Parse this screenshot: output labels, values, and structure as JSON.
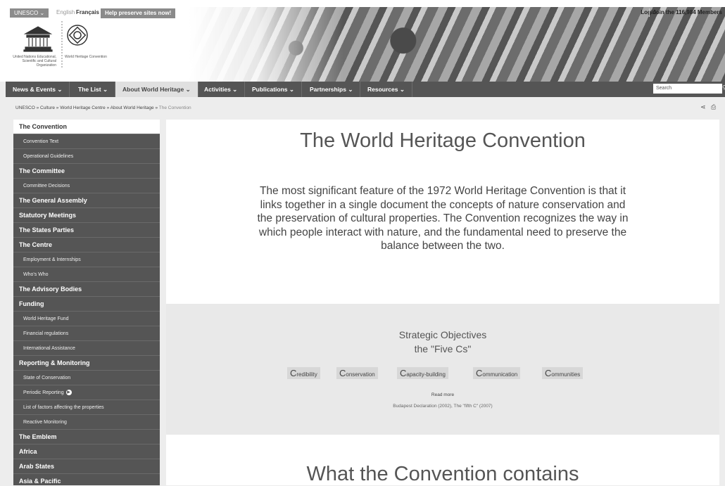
{
  "header": {
    "unesco_label": "UNESCO",
    "lang_en": "English",
    "lang_fr": "Français",
    "help_label": "Help preserve sites now!",
    "login_label": "Login",
    "join_label": "Join the 116,984 Members",
    "org_text": "United Nations Educational, Scientific and Cultural Organization",
    "wh_text": "World Heritage Convention"
  },
  "nav": {
    "items": [
      "News & Events",
      "The List",
      "About World Heritage",
      "Activities",
      "Publications",
      "Partnerships",
      "Resources"
    ],
    "search_placeholder": "Search"
  },
  "breadcrumb": {
    "path": "UNESCO » Culture » World Heritage Centre » About World Heritage »",
    "current": "The Convention"
  },
  "sidebar": {
    "items": [
      {
        "label": "The Convention",
        "level": "top",
        "active": true
      },
      {
        "label": "Convention Text",
        "level": "sub"
      },
      {
        "label": "Operational Guidelines",
        "level": "sub"
      },
      {
        "label": "The Committee",
        "level": "top"
      },
      {
        "label": "Committee Decisions",
        "level": "sub"
      },
      {
        "label": "The General Assembly",
        "level": "top"
      },
      {
        "label": "Statutory Meetings",
        "level": "top"
      },
      {
        "label": "The States Parties",
        "level": "top"
      },
      {
        "label": "The Centre",
        "level": "top"
      },
      {
        "label": "Employment & Internships",
        "level": "sub"
      },
      {
        "label": "Who's Who",
        "level": "sub"
      },
      {
        "label": "The Advisory Bodies",
        "level": "top"
      },
      {
        "label": "Funding",
        "level": "top"
      },
      {
        "label": "World Heritage Fund",
        "level": "sub"
      },
      {
        "label": "Financial regulations",
        "level": "sub"
      },
      {
        "label": "International Assistance",
        "level": "sub"
      },
      {
        "label": "Reporting & Monitoring",
        "level": "top"
      },
      {
        "label": "State of Conservation",
        "level": "sub"
      },
      {
        "label": "Periodic Reporting",
        "level": "sub",
        "has_arrow": true
      },
      {
        "label": "List of factors affecting the properties",
        "level": "sub"
      },
      {
        "label": "Reactive Monitoring",
        "level": "sub"
      },
      {
        "label": "The Emblem",
        "level": "top"
      },
      {
        "label": "Africa",
        "level": "top"
      },
      {
        "label": "Arab States",
        "level": "top"
      },
      {
        "label": "Asia & Pacific",
        "level": "top"
      }
    ]
  },
  "main": {
    "title": "The World Heritage Convention",
    "intro": "The most significant feature of the 1972 World Heritage Convention is that it links together in a single document the concepts of nature conservation and the preservation of cultural properties. The Convention recognizes the way in which people interact with nature, and the fundamental need to preserve the balance between the two.",
    "objectives_title": "Strategic Objectives",
    "objectives_subtitle": "the \"Five Cs\"",
    "five_cs": [
      {
        "initial": "C",
        "rest": "redibility"
      },
      {
        "initial": "C",
        "rest": "onservation"
      },
      {
        "initial": "C",
        "rest": "apacity-building"
      },
      {
        "initial": "C",
        "rest": "ommunication"
      },
      {
        "initial": "C",
        "rest": "ommunities"
      }
    ],
    "read_more": "Read more",
    "budapest_note": "Budapest Declaration (2002), The \"fifth C\" (2007)",
    "contains_title": "What the Convention contains"
  },
  "colors": {
    "nav_bg": "#555555",
    "sidebar_bg": "#555555",
    "page_bg": "#ededed"
  }
}
